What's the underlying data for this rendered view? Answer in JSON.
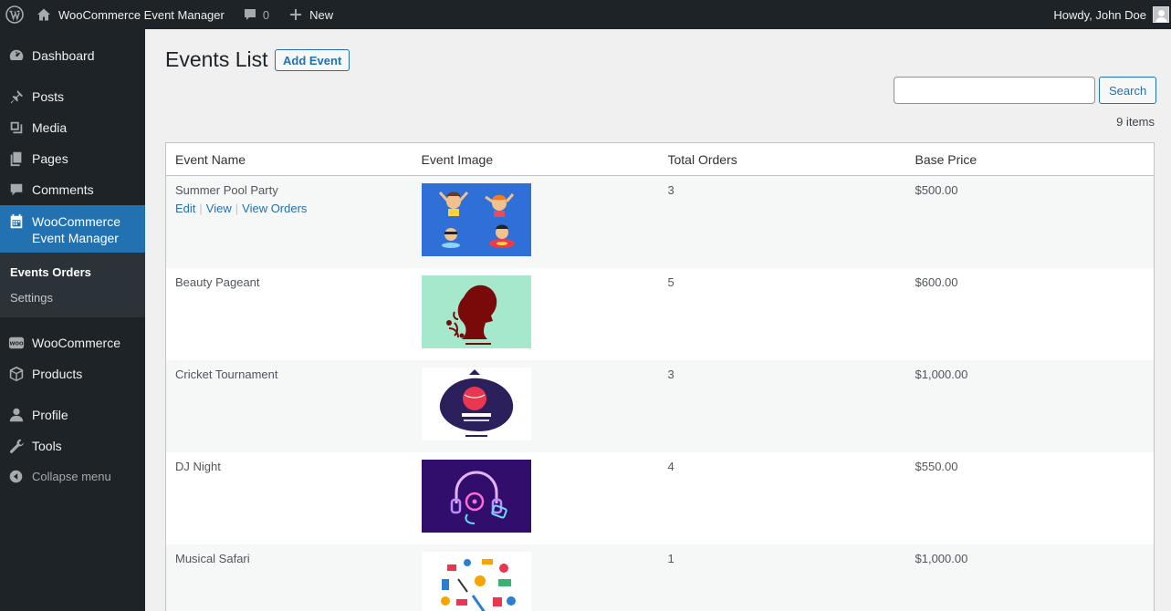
{
  "admin_bar": {
    "site_name": "WooCommerce Event Manager",
    "comments_count": "0",
    "new_label": "New",
    "greeting": "Howdy, John Doe"
  },
  "sidebar": {
    "items": [
      {
        "label": "Dashboard",
        "icon": "dashboard-icon"
      },
      {
        "label": "Posts",
        "icon": "pin-icon"
      },
      {
        "label": "Media",
        "icon": "media-icon"
      },
      {
        "label": "Pages",
        "icon": "pages-icon"
      },
      {
        "label": "Comments",
        "icon": "comments-icon"
      },
      {
        "label": "WooCommerce\nEvent Manager",
        "line1": "WooCommerce",
        "line2": "Event Manager",
        "icon": "calendar-icon",
        "active": true
      },
      {
        "label": "WooCommerce",
        "icon": "woo-icon"
      },
      {
        "label": "Products",
        "icon": "box-icon"
      },
      {
        "label": "Profile",
        "icon": "user-icon"
      },
      {
        "label": "Tools",
        "icon": "wrench-icon"
      },
      {
        "label": "Collapse menu",
        "icon": "collapse-icon"
      }
    ],
    "submenu": [
      {
        "label": "Events Orders",
        "current": true
      },
      {
        "label": "Settings"
      }
    ]
  },
  "page": {
    "title": "Events List",
    "add_button": "Add Event",
    "search_button": "Search",
    "search_value": "",
    "items_count": "9 items"
  },
  "table": {
    "columns": [
      "Event Name",
      "Event Image",
      "Total Orders",
      "Base Price"
    ],
    "row_actions": [
      "Edit",
      "View",
      "View Orders"
    ],
    "rows": [
      {
        "name": "Summer Pool Party",
        "orders": "3",
        "price": "$500.00",
        "image": "pool-party-image"
      },
      {
        "name": "Beauty Pageant",
        "orders": "5",
        "price": "$600.00",
        "image": "beauty-pageant-image"
      },
      {
        "name": "Cricket Tournament",
        "orders": "3",
        "price": "$1,000.00",
        "image": "cricket-image"
      },
      {
        "name": "DJ Night",
        "orders": "4",
        "price": "$550.00",
        "image": "dj-night-image"
      },
      {
        "name": "Musical Safari",
        "orders": "1",
        "price": "$1,000.00",
        "image": "musical-safari-image"
      }
    ]
  },
  "colors": {
    "accent": "#2271b1",
    "sidebar_bg": "#1d2327",
    "submenu_bg": "#2c3338"
  }
}
